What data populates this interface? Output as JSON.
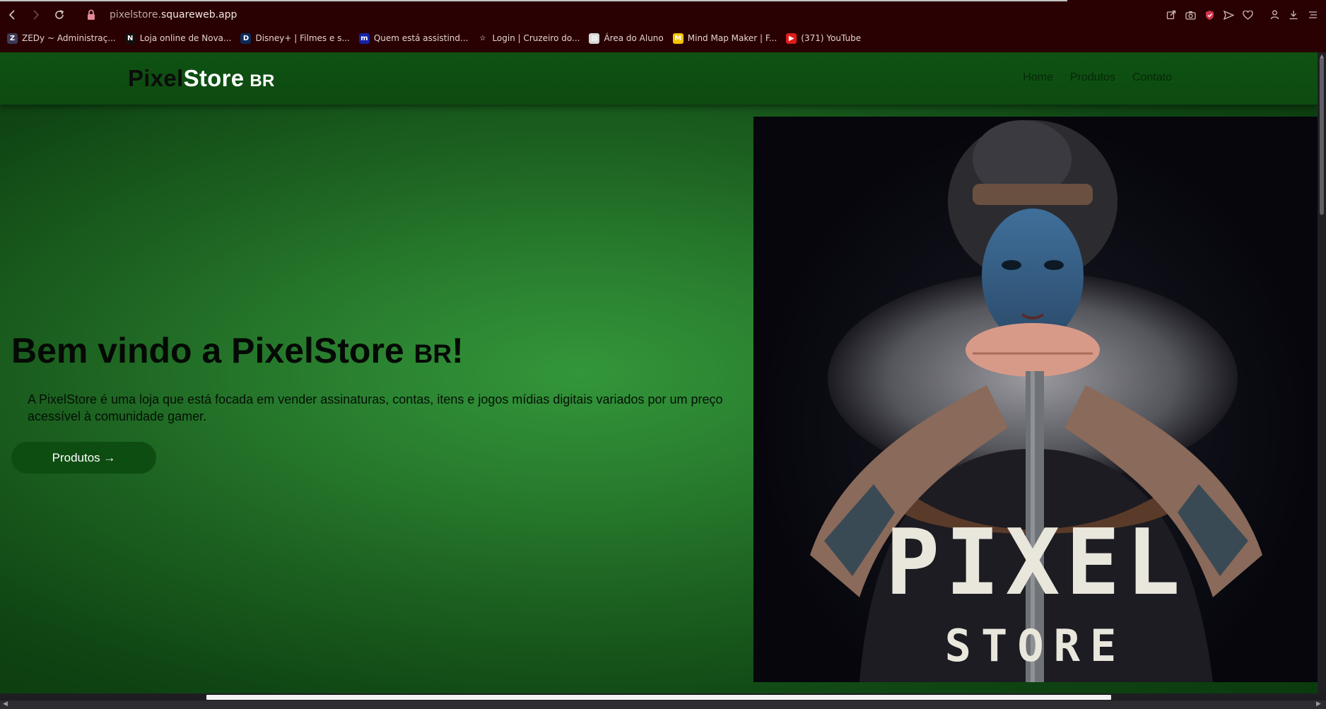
{
  "browser": {
    "url_host": "pixelstore.",
    "url_domain": "squareweb.app",
    "bookmarks": [
      {
        "label": "ZEDy ~ Administraç...",
        "icon": "zedy-favicon",
        "color": "#3b3b55",
        "glyph": "Z"
      },
      {
        "label": "Loja online de Nova...",
        "icon": "nuvemshop-favicon",
        "color": "#111111",
        "glyph": "N"
      },
      {
        "label": "Disney+ | Filmes e s...",
        "icon": "disney-favicon",
        "color": "#0b2a5a",
        "glyph": "D"
      },
      {
        "label": "Quem está assistind...",
        "icon": "max-favicon",
        "color": "#1422a8",
        "glyph": "m"
      },
      {
        "label": "Login | Cruzeiro do...",
        "icon": "cruzeiro-star-favicon",
        "color": "#2a0102",
        "glyph": "☆"
      },
      {
        "label": "Área do Aluno",
        "icon": "area-aluno-favicon",
        "color": "#d8d8d8",
        "glyph": "▤"
      },
      {
        "label": "Mind Map Maker | F...",
        "icon": "miro-favicon",
        "color": "#f5c400",
        "glyph": "M"
      },
      {
        "label": "(371) YouTube",
        "icon": "youtube-favicon",
        "color": "#e21a1a",
        "glyph": "▶"
      }
    ]
  },
  "site": {
    "logo_part1": "Pixel",
    "logo_part2": "Store",
    "logo_part3": "BR",
    "nav": [
      "Home",
      "Produtos",
      "Contato"
    ],
    "hero_title": "Bem vindo a PixelStore",
    "hero_title_small": "BR",
    "hero_title_end": "!",
    "hero_text": "A PixelStore é uma loja que está focada em vender assinaturas, contas, itens e jogos mídias digitais variados por um preço acessível à comunidade gamer.",
    "cta_label": "Produtos →",
    "art_word1": "PIXEL",
    "art_word2": "STORE"
  },
  "colors": {
    "chrome_bg": "#2a0102",
    "navbar_bg": "#0d4a11",
    "hero_green": "#33963a",
    "cta_bg": "#0e4d12"
  }
}
